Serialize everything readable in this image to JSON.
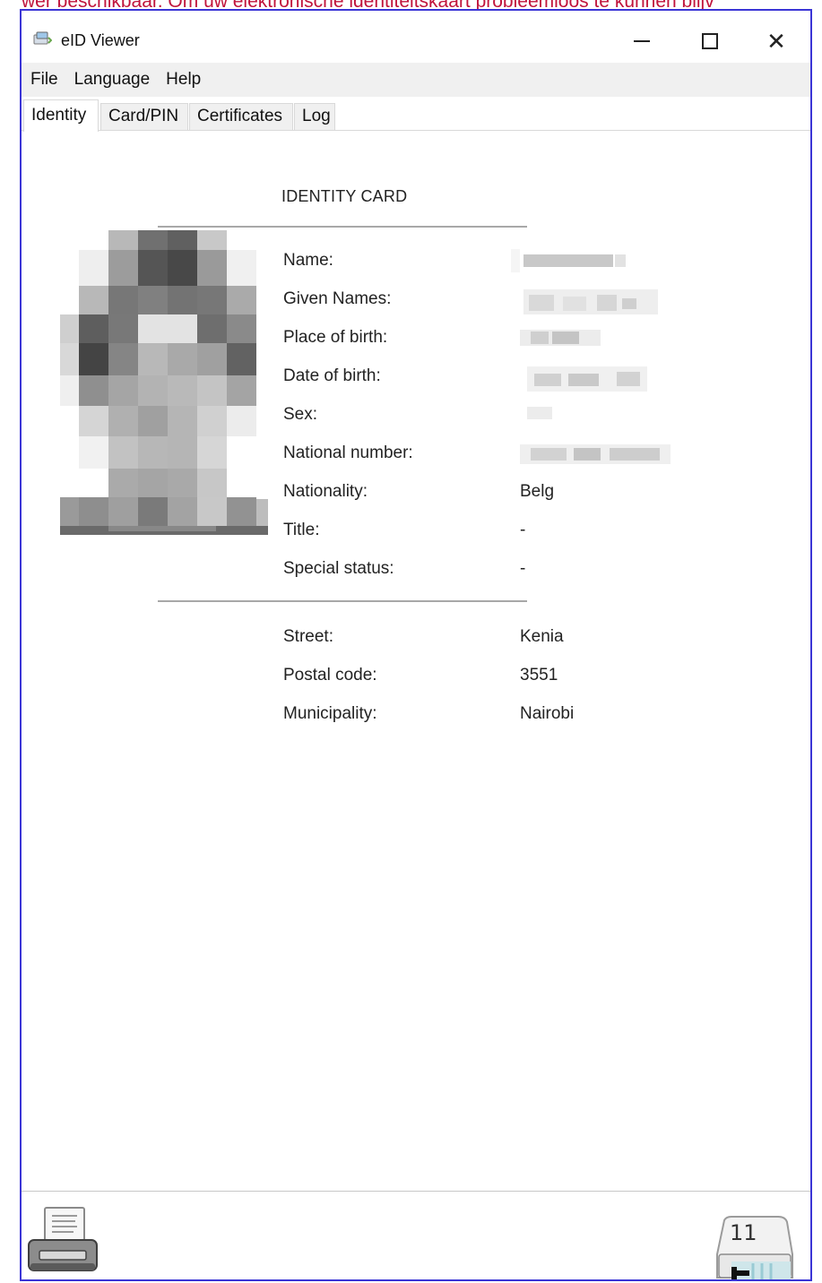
{
  "background": {
    "text": "wer beschikbaar. Om uw elektronische identiteitskaart probleemloos te kunnen blijv"
  },
  "window": {
    "title": "eID Viewer",
    "app_icon": "eid-card-reader-icon",
    "controls": {
      "minimize_icon": "minimize-icon",
      "maximize_icon": "maximize-icon",
      "close_symbol": "✕"
    }
  },
  "menu": {
    "items": [
      {
        "label": "File"
      },
      {
        "label": "Language"
      },
      {
        "label": "Help"
      }
    ]
  },
  "tabs": [
    {
      "label": "Identity",
      "active": true
    },
    {
      "label": "Card/PIN",
      "active": false
    },
    {
      "label": "Certificates",
      "active": false
    },
    {
      "label": "Log",
      "active": false
    }
  ],
  "identity": {
    "heading": "IDENTITY CARD",
    "photo_icon": "pixelated-portrait",
    "fields": [
      {
        "label": "Name:",
        "value": ""
      },
      {
        "label": "Given Names:",
        "value": ""
      },
      {
        "label": "Place of birth:",
        "value": ""
      },
      {
        "label": "Date of birth:",
        "value": ""
      },
      {
        "label": "Sex:",
        "value": ""
      },
      {
        "label": "National number:",
        "value": ""
      },
      {
        "label": "Nationality:",
        "value": "Belg"
      },
      {
        "label": "Title:",
        "value": "-"
      },
      {
        "label": "Special status:",
        "value": "-"
      }
    ],
    "address": [
      {
        "label": "Street:",
        "value": "Kenia"
      },
      {
        "label": "Postal code:",
        "value": "3551"
      },
      {
        "label": "Municipality:",
        "value": "Nairobi"
      }
    ]
  },
  "footer": {
    "print_icon": "printer-icon",
    "reader_icon": "card-reader-icon",
    "reader_count": "11"
  },
  "colors": {
    "window_border": "#3b35d6",
    "background_text": "#c0143c",
    "menu_background": "#f0f0f0"
  }
}
